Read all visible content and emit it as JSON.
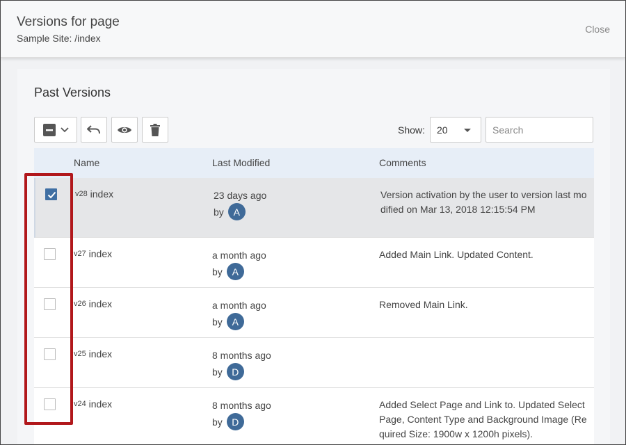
{
  "header": {
    "title": "Versions for page",
    "subtitle": "Sample Site: /index",
    "close_label": "Close"
  },
  "panel": {
    "title": "Past Versions",
    "show_label": "Show:",
    "show_value": "20",
    "search_placeholder": "Search",
    "columns": {
      "name": "Name",
      "modified": "Last Modified",
      "comments": "Comments"
    }
  },
  "icons": {
    "select_all": "minus-square-icon",
    "dropdown": "chevron-down-icon",
    "restore": "undo-icon",
    "view": "eye-icon",
    "delete": "trash-icon"
  },
  "colors": {
    "accent": "#3f6fa3",
    "avatar": "#3f6a98",
    "highlight": "#b1171b",
    "header_row": "#e7eef7"
  },
  "rows": [
    {
      "ver": "v28",
      "name": "index",
      "modified": "23 days ago",
      "by": "by",
      "user": "A",
      "checked": true,
      "comment": "Version activation by the user             to version last modified on Mar 13, 2018 12:15:54 PM"
    },
    {
      "ver": "v27",
      "name": "index",
      "modified": "a month ago",
      "by": "by",
      "user": "A",
      "checked": false,
      "comment": "Added Main Link. Updated Content."
    },
    {
      "ver": "v26",
      "name": "index",
      "modified": "a month ago",
      "by": "by",
      "user": "A",
      "checked": false,
      "comment": "Removed Main Link."
    },
    {
      "ver": "v25",
      "name": "index",
      "modified": "8 months ago",
      "by": "by",
      "user": "D",
      "checked": false,
      "comment": ""
    },
    {
      "ver": "v24",
      "name": "index",
      "modified": "8 months ago",
      "by": "by",
      "user": "D",
      "checked": false,
      "comment": "Added Select Page and Link to. Updated Select Page, Content Type and Background Image (Required Size: 1900w x 1200h pixels)."
    }
  ]
}
